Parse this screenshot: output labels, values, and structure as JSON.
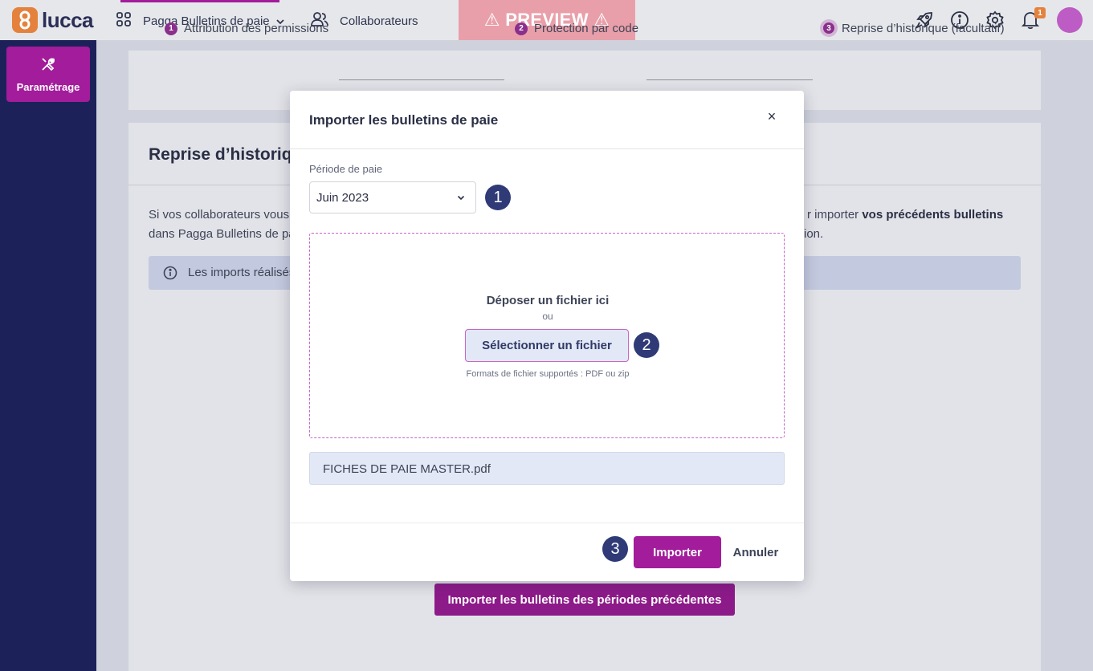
{
  "topbar": {
    "logo_text": "lucca",
    "app_menu_label": "Pagga Bulletins de paie",
    "people_label": "Collaborateurs",
    "preview_label": "⚠ PREVIEW ⚠",
    "notification_count": "1",
    "colors": {
      "accent": "#a21c9b",
      "logo": "#e4823d",
      "preview_bg": "#e99fa9"
    }
  },
  "sidebar": {
    "items": [
      {
        "label": "Paramétrage",
        "icon": "tools-icon"
      }
    ]
  },
  "stepper": {
    "steps": [
      {
        "num": "1",
        "label": "Attribution des permissions"
      },
      {
        "num": "2",
        "label": "Protection par code"
      },
      {
        "num": "3",
        "label": "Reprise d’historique (facultatif)"
      }
    ]
  },
  "page": {
    "title": "Reprise d’historique",
    "para_line1_left": "Si vos collaborateurs vous",
    "para_line1_right_a": "r importer ",
    "para_line1_right_b": "vos précédents bulletins",
    "para_line2_left": "dans Pagga Bulletins de pa",
    "para_line2_right": "ion.",
    "info_text": "Les imports réalisés",
    "bottom_button": "Importer les bulletins des périodes précédentes"
  },
  "modal": {
    "title": "Importer les bulletins de paie",
    "close_glyph": "×",
    "period_label": "Période de paie",
    "period_value": "Juin 2023",
    "dropzone_title": "Déposer un fichier ici",
    "dropzone_or": "ou",
    "select_file_button": "Sélectionner un fichier",
    "formats_text": "Formats de fichier supportés : PDF ou zip",
    "file_name": "FICHES DE PAIE MASTER.pdf",
    "import_button": "Importer",
    "cancel_button": "Annuler"
  },
  "markers": [
    "1",
    "2",
    "3"
  ]
}
